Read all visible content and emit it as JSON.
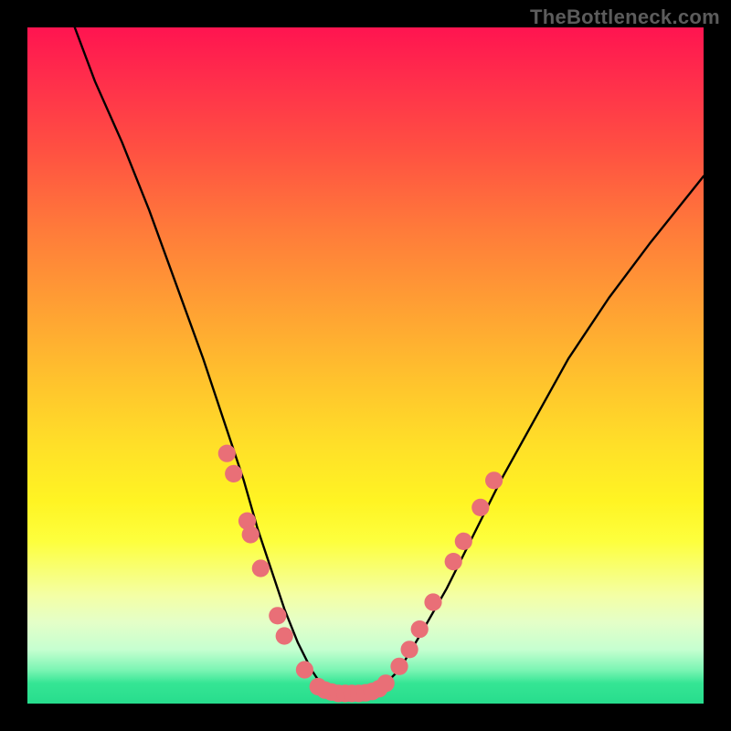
{
  "attribution": "TheBottleneck.com",
  "chart_data": {
    "type": "line",
    "title": "",
    "xlabel": "",
    "ylabel": "",
    "xlim": [
      0,
      100
    ],
    "ylim": [
      0,
      100
    ],
    "grid": false,
    "legend": false,
    "series": [
      {
        "name": "bottleneck-curve",
        "x": [
          7,
          10,
          14,
          18,
          22,
          26,
          29,
          32,
          34,
          36,
          38,
          40,
          42,
          44,
          46,
          48,
          50,
          52,
          55,
          58,
          62,
          66,
          70,
          75,
          80,
          86,
          92,
          100
        ],
        "y": [
          100,
          92,
          83,
          73,
          62,
          51,
          42,
          33,
          26,
          20,
          14,
          9,
          5,
          2,
          1,
          1,
          1,
          2,
          5,
          10,
          17,
          25,
          33,
          42,
          51,
          60,
          68,
          78
        ]
      }
    ],
    "markers": {
      "name": "highlight-points",
      "color": "#e96f77",
      "radius_pct": 1.3,
      "points": [
        {
          "x": 29.5,
          "y": 37
        },
        {
          "x": 30.5,
          "y": 34
        },
        {
          "x": 32.5,
          "y": 27
        },
        {
          "x": 33,
          "y": 25
        },
        {
          "x": 34.5,
          "y": 20
        },
        {
          "x": 37,
          "y": 13
        },
        {
          "x": 38,
          "y": 10
        },
        {
          "x": 41,
          "y": 5
        },
        {
          "x": 43,
          "y": 2.5
        },
        {
          "x": 44,
          "y": 2
        },
        {
          "x": 45,
          "y": 1.7
        },
        {
          "x": 46,
          "y": 1.5
        },
        {
          "x": 47,
          "y": 1.5
        },
        {
          "x": 48,
          "y": 1.5
        },
        {
          "x": 49,
          "y": 1.5
        },
        {
          "x": 50,
          "y": 1.6
        },
        {
          "x": 51,
          "y": 1.8
        },
        {
          "x": 52,
          "y": 2.2
        },
        {
          "x": 53,
          "y": 3
        },
        {
          "x": 55,
          "y": 5.5
        },
        {
          "x": 56.5,
          "y": 8
        },
        {
          "x": 58,
          "y": 11
        },
        {
          "x": 60,
          "y": 15
        },
        {
          "x": 63,
          "y": 21
        },
        {
          "x": 64.5,
          "y": 24
        },
        {
          "x": 67,
          "y": 29
        },
        {
          "x": 69,
          "y": 33
        }
      ]
    }
  }
}
